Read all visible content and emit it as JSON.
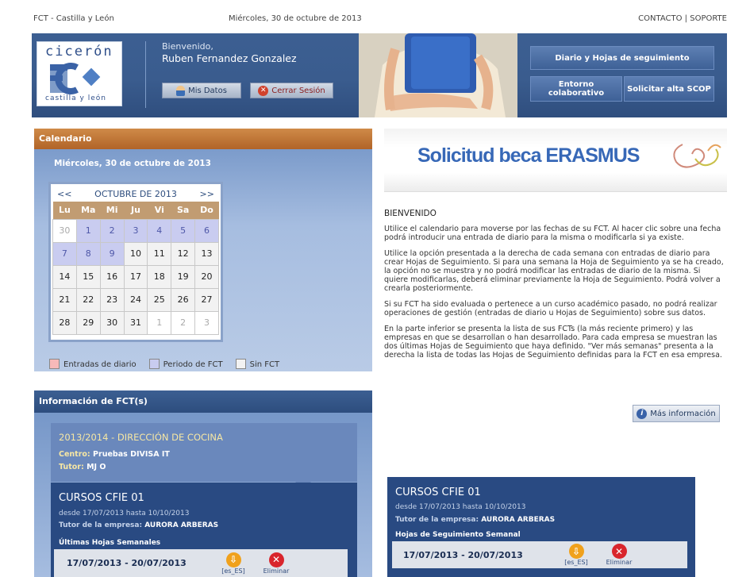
{
  "topbar": {
    "region": "FCT - Castilla y León",
    "date": "Miércoles, 30 de octubre de 2013",
    "contact": "CONTACTO",
    "separator": "|",
    "support": "SOPORTE"
  },
  "logo": {
    "text_top": "cicerón",
    "text_bottom": "castilla y león"
  },
  "header": {
    "greeting": "Bienvenido,",
    "user_name": "Ruben Fernandez Gonzalez",
    "my_data": "Mis Datos",
    "logout": "Cerrar Sesión",
    "diary_button": "Diario y Hojas de seguimiento",
    "collab_button": "Entorno colaborativo",
    "request_button": "Solicitar alta SCOP"
  },
  "calendar_panel": {
    "title": "Calendario",
    "date": "Miércoles, 30 de octubre de 2013",
    "prev": "<<",
    "next": ">>",
    "month": "OCTUBRE DE 2013",
    "weekdays": [
      "Lu",
      "Ma",
      "Mi",
      "Ju",
      "Vi",
      "Sa",
      "Do"
    ],
    "weeks": [
      [
        "30",
        "1",
        "2",
        "3",
        "4",
        "5",
        "6"
      ],
      [
        "7",
        "8",
        "9",
        "10",
        "11",
        "12",
        "13"
      ],
      [
        "14",
        "15",
        "16",
        "17",
        "18",
        "19",
        "20"
      ],
      [
        "21",
        "22",
        "23",
        "24",
        "25",
        "26",
        "27"
      ],
      [
        "28",
        "29",
        "30",
        "31",
        "1",
        "2",
        "3"
      ]
    ],
    "legend": [
      "Entradas de diario",
      "Periodo de FCT",
      "Sin FCT"
    ],
    "legend_colors": [
      "#f7b9b9",
      "#c9ccf0",
      "#f2f2f2"
    ]
  },
  "fct_panel": {
    "title": "Información de FCT(s)",
    "course": "2013/2014 - DIRECCIÓN DE COCINA",
    "center_label": "Centro:",
    "center": "Pruebas DIVISA IT",
    "tutor_label": "Tutor:",
    "tutor": "MJ O"
  },
  "company_left": {
    "name": "CURSOS CFIE 01",
    "dates": "desde 17/07/2013 hasta 10/10/2013",
    "tutor_label": "Tutor de la empresa:",
    "tutor": "AURORA ARBERAS",
    "sheets_label": "Últimas Hojas Semanales",
    "sheet": "17/07/2013 - 20/07/2013",
    "download_label": "[es_ES]",
    "delete_label": "Eliminar"
  },
  "company_right": {
    "name": "CURSOS CFIE 01",
    "dates": "desde 17/07/2013 hasta 10/10/2013",
    "tutor_label": "Tutor de la empresa:",
    "tutor": "AURORA ARBERAS",
    "sheets_label": "Hojas de Seguimiento Semanal",
    "sheet": "17/07/2013 - 20/07/2013",
    "download_label": "[es_ES]",
    "delete_label": "Eliminar"
  },
  "banner": {
    "text": "Solicitud beca ERASMUS"
  },
  "welcome_text": {
    "title": "BIENVENIDO",
    "paragraphs": [
      "Utilice el calendario para moverse por las fechas de su FCT. Al hacer clic sobre una fecha podrá introducir una entrada de diario para la misma o modificarla si ya existe.",
      "Utilice la opción presentada a la derecha de cada semana con entradas de diario para crear Hojas de Seguimiento. Si para una semana la Hoja de Seguimiento ya se ha creado, la opción no se muestra y no podrá modificar las entradas de diario de la misma. Si quiere modificarlas, deberá eliminar previamente la Hoja de Seguimiento. Podrá volver a crearla posteriormente.",
      "Si su FCT ha sido evaluada o pertenece a un curso académico pasado, no podrá realizar operaciones de gestión (entradas de diario u Hojas de Seguimiento) sobre sus datos.",
      "En la parte inferior se presenta la lista de sus FCTs (la más reciente primero) y las empresas en que se desarrollan o han desarrollado. Para cada empresa se muestran las dos últimas Hojas de Seguimiento que haya definido. \"Ver más semanas\" presenta a la derecha la lista de todas las Hojas de Seguimiento definidas para la FCT en esa empresa."
    ],
    "more_info": "Más información"
  }
}
